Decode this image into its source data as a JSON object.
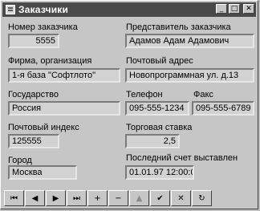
{
  "window": {
    "title": "Заказчики",
    "buttons": {
      "minimize": "_",
      "maximize": "□",
      "close": "✕"
    }
  },
  "form": {
    "customer_no": {
      "label": "Номер заказчика",
      "value": "5555"
    },
    "representative": {
      "label": "Представитель заказчика",
      "value": "Адамов Адам Адамович"
    },
    "company": {
      "label": "Фирма, организация",
      "value": "1-я база \"Софтлото\""
    },
    "address": {
      "label": "Почтовый адрес",
      "value": "Новопрограммная ул. д.13"
    },
    "country": {
      "label": "Государство",
      "value": "Россия"
    },
    "phone": {
      "label": "Телефон",
      "value": "095-555-1234"
    },
    "fax": {
      "label": "Факс",
      "value": "095-555-6789"
    },
    "zip": {
      "label": "Почтовый индекс",
      "value": "125555"
    },
    "tax_rate": {
      "label": "Торговая ставка",
      "value": "2,5"
    },
    "city": {
      "label": "Город",
      "value": "Москва"
    },
    "last_invoice": {
      "label": "Последний счет выставлен",
      "value": "01.01.97 12:00:0"
    }
  },
  "navigator": {
    "first": "⏮",
    "prior": "◀",
    "next": "▶",
    "last": "⏭",
    "insert": "+",
    "delete": "−",
    "edit": "▲",
    "post": "✔",
    "cancel": "✕",
    "refresh": "↻"
  }
}
